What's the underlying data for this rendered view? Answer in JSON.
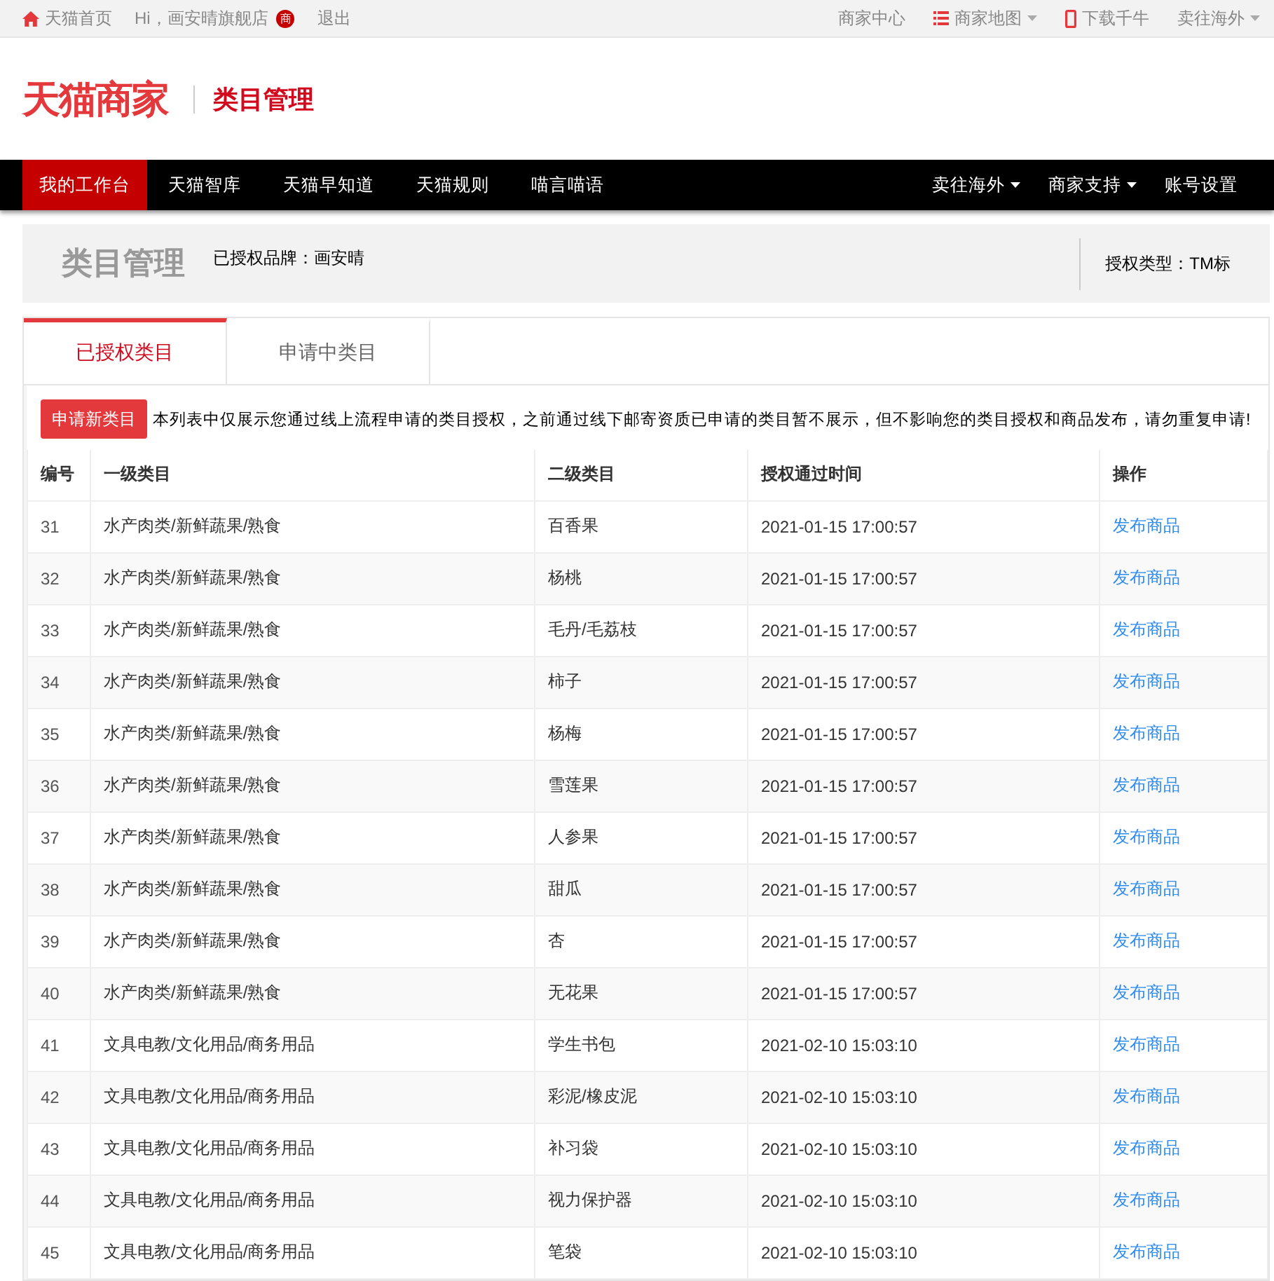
{
  "top_bar": {
    "left": [
      {
        "kind": "home",
        "label": "天猫首页"
      },
      {
        "kind": "text",
        "label": "Hi，画安晴旗舰店"
      },
      {
        "kind": "badge",
        "label": "商"
      },
      {
        "kind": "text",
        "label": "退出"
      }
    ],
    "right": [
      {
        "kind": "text",
        "label": "商家中心"
      },
      {
        "kind": "list",
        "label": "商家地图",
        "dropdown": true
      },
      {
        "kind": "phone",
        "label": "下载千牛"
      },
      {
        "kind": "text",
        "label": "卖往海外",
        "dropdown": true
      }
    ]
  },
  "header": {
    "logo": "天猫商家",
    "title": "类目管理"
  },
  "nav": {
    "left": [
      {
        "label": "我的工作台",
        "selected": true
      },
      {
        "label": "天猫智库",
        "selected": false
      },
      {
        "label": "天猫早知道",
        "selected": false
      },
      {
        "label": "天猫规则",
        "selected": false
      },
      {
        "label": "喵言喵语",
        "selected": false
      }
    ],
    "right": [
      {
        "label": "卖往海外",
        "dropdown": true
      },
      {
        "label": "商家支持",
        "dropdown": true
      },
      {
        "label": "账号设置",
        "dropdown": false
      }
    ]
  },
  "summary": {
    "title": "类目管理",
    "brand": "已授权品牌：画安晴",
    "type": "授权类型：TM标"
  },
  "tabs": [
    {
      "label": "已授权类目",
      "selected": true
    },
    {
      "label": "申请中类目",
      "selected": false
    }
  ],
  "apply_button": "申请新类目",
  "notice": "本列表中仅展示您通过线上流程申请的类目授权，之前通过线下邮寄资质已申请的类目暂不展示，但不影响您的类目授权和商品发布，请勿重复申请!",
  "table": {
    "columns": [
      "编号",
      "一级类目",
      "二级类目",
      "授权通过时间",
      "操作"
    ],
    "rows": [
      [
        "31",
        "水产肉类/新鲜蔬果/熟食",
        "百香果",
        "2021-01-15 17:00:57",
        "发布商品"
      ],
      [
        "32",
        "水产肉类/新鲜蔬果/熟食",
        "杨桃",
        "2021-01-15 17:00:57",
        "发布商品"
      ],
      [
        "33",
        "水产肉类/新鲜蔬果/熟食",
        "毛丹/毛荔枝",
        "2021-01-15 17:00:57",
        "发布商品"
      ],
      [
        "34",
        "水产肉类/新鲜蔬果/熟食",
        "柿子",
        "2021-01-15 17:00:57",
        "发布商品"
      ],
      [
        "35",
        "水产肉类/新鲜蔬果/熟食",
        "杨梅",
        "2021-01-15 17:00:57",
        "发布商品"
      ],
      [
        "36",
        "水产肉类/新鲜蔬果/熟食",
        "雪莲果",
        "2021-01-15 17:00:57",
        "发布商品"
      ],
      [
        "37",
        "水产肉类/新鲜蔬果/熟食",
        "人参果",
        "2021-01-15 17:00:57",
        "发布商品"
      ],
      [
        "38",
        "水产肉类/新鲜蔬果/熟食",
        "甜瓜",
        "2021-01-15 17:00:57",
        "发布商品"
      ],
      [
        "39",
        "水产肉类/新鲜蔬果/熟食",
        "杏",
        "2021-01-15 17:00:57",
        "发布商品"
      ],
      [
        "40",
        "水产肉类/新鲜蔬果/熟食",
        "无花果",
        "2021-01-15 17:00:57",
        "发布商品"
      ],
      [
        "41",
        "文具电教/文化用品/商务用品",
        "学生书包",
        "2021-02-10 15:03:10",
        "发布商品"
      ],
      [
        "42",
        "文具电教/文化用品/商务用品",
        "彩泥/橡皮泥",
        "2021-02-10 15:03:10",
        "发布商品"
      ],
      [
        "43",
        "文具电教/文化用品/商务用品",
        "补习袋",
        "2021-02-10 15:03:10",
        "发布商品"
      ],
      [
        "44",
        "文具电教/文化用品/商务用品",
        "视力保护器",
        "2021-02-10 15:03:10",
        "发布商品"
      ],
      [
        "45",
        "文具电教/文化用品/商务用品",
        "笔袋",
        "2021-02-10 15:03:10",
        "发布商品"
      ]
    ]
  }
}
